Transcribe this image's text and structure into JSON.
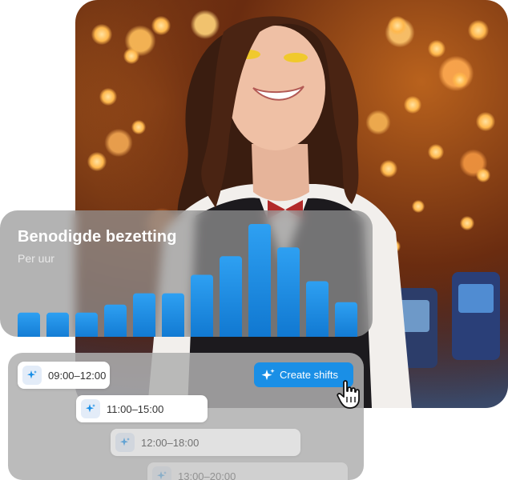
{
  "chart_card": {
    "title": "Benodigde bezetting",
    "subtitle": "Per uur"
  },
  "chart_data": {
    "type": "bar",
    "title": "Benodigde bezetting",
    "subtitle": "Per uur",
    "categories": [
      "",
      "",
      "",
      "",
      "",
      "",
      "",
      "",
      "",
      "",
      "",
      ""
    ],
    "values": [
      30,
      30,
      30,
      40,
      54,
      54,
      77,
      100,
      140,
      111,
      69,
      43
    ],
    "ylim": [
      0,
      140
    ],
    "grid": false,
    "bar_color": "#1a8fe6"
  },
  "shifts": [
    {
      "label": "09:00–12:00"
    },
    {
      "label": "11:00–15:00"
    },
    {
      "label": "12:00–18:00"
    },
    {
      "label": "13:00–20:00"
    }
  ],
  "actions": {
    "create_shifts": "Create shifts"
  },
  "icons": {
    "shift_icon": "sparkle-icon",
    "create_icon": "sparkle-icon",
    "cursor": "hand-pointer-icon"
  },
  "colors": {
    "accent": "#1a8fe6",
    "bar_top": "#2ea0f2",
    "bar_bottom": "#0f76cf"
  }
}
